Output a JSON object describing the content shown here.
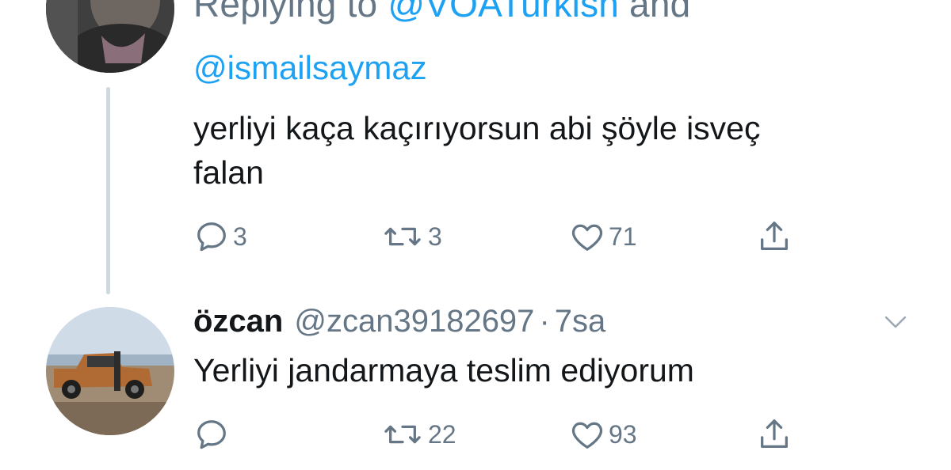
{
  "tweets": [
    {
      "reply_prefix": "Replying to ",
      "reply_to": "@VOATurkish",
      "reply_conj": " and",
      "reply_mention": "@ismailsaymaz",
      "text_line1": "yerliyi kaça kaçırıyorsun abi şöyle isveç",
      "text_line2": "falan",
      "reply_count": "3",
      "retweet_count": "3",
      "like_count": "71",
      "icons": [
        "reply-icon",
        "retweet-icon",
        "like-icon",
        "share-icon"
      ]
    },
    {
      "name": "özcan",
      "handle": "@zcan39182697",
      "separator": "·",
      "time": "7sa",
      "text": "Yerliyi jandarmaya teslim ediyorum",
      "reply_count": "",
      "retweet_count": "22",
      "like_count": "93",
      "icons": [
        "reply-icon",
        "retweet-icon",
        "like-icon",
        "share-icon",
        "chevron-down-icon"
      ]
    }
  ],
  "colors": {
    "link": "#1da1f2",
    "text": "#14171a",
    "muted": "#657786",
    "thread_line": "#cfd9de"
  }
}
